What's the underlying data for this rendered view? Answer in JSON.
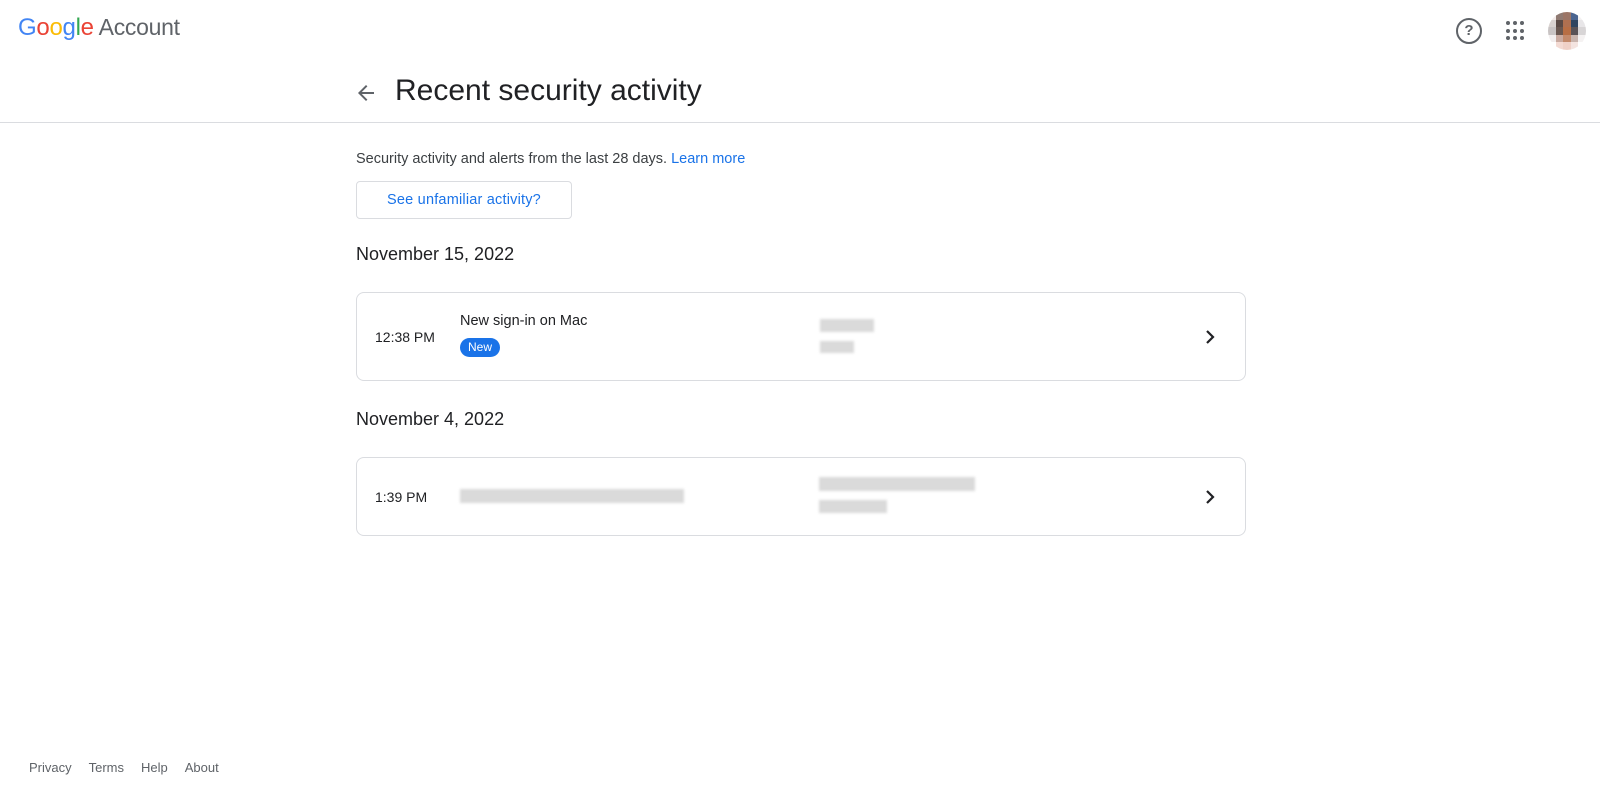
{
  "topbar": {
    "logo_letters": [
      "G",
      "o",
      "o",
      "g",
      "l",
      "e"
    ],
    "product": "Account",
    "help_icon": "help-circle-icon",
    "help_glyph": "?",
    "apps_icon": "apps-grid-icon",
    "avatar": "user-avatar"
  },
  "header": {
    "back_icon": "arrow-back-icon",
    "title": "Recent security activity"
  },
  "intro": {
    "text": "Security activity and alerts from the last 28 days. ",
    "learn_more": "Learn more"
  },
  "unfamiliar_button": "See unfamiliar activity?",
  "groups": [
    {
      "date": "November 15, 2022",
      "events": [
        {
          "time": "12:38 PM",
          "title": "New sign-in on Mac",
          "badge": "New",
          "details_redacted": true,
          "chevron_icon": "chevron-right-icon"
        }
      ]
    },
    {
      "date": "November 4, 2022",
      "events": [
        {
          "time": "1:39 PM",
          "title_redacted": true,
          "details_redacted": true,
          "chevron_icon": "chevron-right-icon"
        }
      ]
    }
  ],
  "colors": {
    "accent": "#1a73e8",
    "badge_bg": "#1a73e8",
    "border": "#dadce0",
    "text": "#202124",
    "muted": "#5f6368"
  },
  "footer": {
    "links": [
      "Privacy",
      "Terms",
      "Help",
      "About"
    ]
  }
}
